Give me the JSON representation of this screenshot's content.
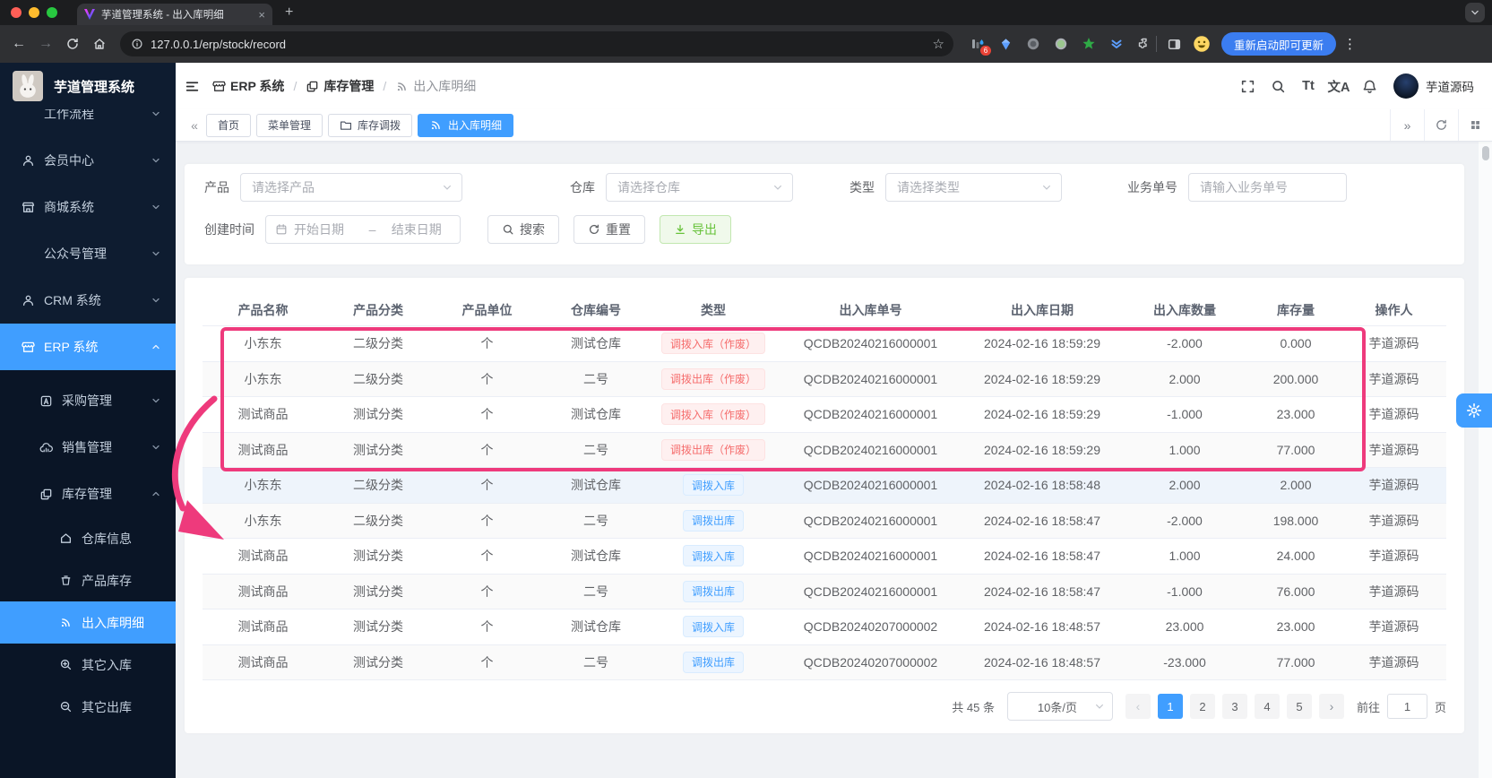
{
  "colors": {
    "accent": "#409eff",
    "annotation": "#ee3a7c",
    "danger": "#f56c6c",
    "success": "#67c23a",
    "sidebar_bg": "#0e1c30"
  },
  "glyphs": {
    "back": "←",
    "forward": "→",
    "star": "☆",
    "newtab": "+",
    "close": "×",
    "dots": "⋮",
    "collapse": "«",
    "expand": "»",
    "prev": "‹",
    "next": "›"
  },
  "browser": {
    "tab_title": "芋道管理系统 - 出入库明细",
    "url": "127.0.0.1/erp/stock/record",
    "extension_badge": "6",
    "update_button": "重新启动即可更新"
  },
  "sidebar": {
    "app_title": "芋道管理系统",
    "items": [
      {
        "label": "工作流程",
        "icon": null,
        "chevron": "down",
        "level": 1,
        "active": false
      },
      {
        "label": "会员中心",
        "icon": "member",
        "chevron": "down",
        "level": 1,
        "active": false
      },
      {
        "label": "商城系统",
        "icon": "mall",
        "chevron": "down",
        "level": 1,
        "active": false
      },
      {
        "label": "公众号管理",
        "icon": null,
        "chevron": "down",
        "level": 1,
        "active": false
      },
      {
        "label": "CRM 系统",
        "icon": "user",
        "chevron": "down",
        "level": 1,
        "active": false
      },
      {
        "label": "ERP 系统",
        "icon": "store",
        "chevron": "up",
        "level": 1,
        "active": true
      },
      {
        "label": "采购管理",
        "icon": "purchase",
        "chevron": "down",
        "level": 2,
        "active": false
      },
      {
        "label": "销售管理",
        "icon": "sale",
        "chevron": "down",
        "level": 2,
        "active": false
      },
      {
        "label": "库存管理",
        "icon": "stock",
        "chevron": "up",
        "level": 2,
        "active": false
      },
      {
        "label": "仓库信息",
        "icon": "house",
        "chevron": null,
        "level": 3,
        "active": false
      },
      {
        "label": "产品库存",
        "icon": "cup",
        "chevron": null,
        "level": 3,
        "active": false
      },
      {
        "label": "出入库明细",
        "icon": "signal",
        "chevron": null,
        "level": 3,
        "active": true
      },
      {
        "label": "其它入库",
        "icon": "zoom-in",
        "chevron": null,
        "level": 3,
        "active": false
      },
      {
        "label": "其它出库",
        "icon": "zoom-out",
        "chevron": null,
        "level": 3,
        "active": false
      }
    ]
  },
  "header": {
    "breadcrumb": [
      {
        "label": "ERP 系统",
        "icon": "store"
      },
      {
        "label": "库存管理",
        "icon": "stock"
      },
      {
        "label": "出入库明细",
        "icon": "signal"
      }
    ],
    "tt_icon": "Tt",
    "translate_icon": "文A",
    "username": "芋道源码"
  },
  "tabs": {
    "items": [
      {
        "label": "首页",
        "icon": null,
        "active": false
      },
      {
        "label": "菜单管理",
        "icon": null,
        "active": false
      },
      {
        "label": "库存调拨",
        "icon": "folder",
        "active": false
      },
      {
        "label": "出入库明细",
        "icon": "signal",
        "active": true
      }
    ]
  },
  "filters": {
    "product_label": "产品",
    "product_placeholder": "请选择产品",
    "warehouse_label": "仓库",
    "warehouse_placeholder": "请选择仓库",
    "type_label": "类型",
    "type_placeholder": "请选择类型",
    "bizno_label": "业务单号",
    "bizno_placeholder": "请输入业务单号",
    "created_label": "创建时间",
    "date_start_placeholder": "开始日期",
    "date_separator": "–",
    "date_end_placeholder": "结束日期",
    "search_button": "搜索",
    "reset_button": "重置",
    "export_button": "导出"
  },
  "table": {
    "columns": [
      "产品名称",
      "产品分类",
      "产品单位",
      "仓库编号",
      "类型",
      "出入库单号",
      "出入库日期",
      "出入库数量",
      "库存量",
      "操作人"
    ],
    "rows": [
      {
        "product": "小东东",
        "category": "二级分类",
        "unit": "个",
        "warehouse": "测试仓库",
        "type": "调拨入库（作废）",
        "type_style": "danger",
        "order_no": "QCDB20240216000001",
        "date": "2024-02-16 18:59:29",
        "quantity": "-2.000",
        "stock": "0.000",
        "operator": "芋道源码"
      },
      {
        "product": "小东东",
        "category": "二级分类",
        "unit": "个",
        "warehouse": "二号",
        "type": "调拨出库（作废）",
        "type_style": "danger",
        "order_no": "QCDB20240216000001",
        "date": "2024-02-16 18:59:29",
        "quantity": "2.000",
        "stock": "200.000",
        "operator": "芋道源码"
      },
      {
        "product": "测试商品",
        "category": "测试分类",
        "unit": "个",
        "warehouse": "测试仓库",
        "type": "调拨入库（作废）",
        "type_style": "danger",
        "order_no": "QCDB20240216000001",
        "date": "2024-02-16 18:59:29",
        "quantity": "-1.000",
        "stock": "23.000",
        "operator": "芋道源码"
      },
      {
        "product": "测试商品",
        "category": "测试分类",
        "unit": "个",
        "warehouse": "二号",
        "type": "调拨出库（作废）",
        "type_style": "danger",
        "order_no": "QCDB20240216000001",
        "date": "2024-02-16 18:59:29",
        "quantity": "1.000",
        "stock": "77.000",
        "operator": "芋道源码"
      },
      {
        "product": "小东东",
        "category": "二级分类",
        "unit": "个",
        "warehouse": "测试仓库",
        "type": "调拨入库",
        "type_style": "primary",
        "order_no": "QCDB20240216000001",
        "date": "2024-02-16 18:58:48",
        "quantity": "2.000",
        "stock": "2.000",
        "operator": "芋道源码"
      },
      {
        "product": "小东东",
        "category": "二级分类",
        "unit": "个",
        "warehouse": "二号",
        "type": "调拨出库",
        "type_style": "primary",
        "order_no": "QCDB20240216000001",
        "date": "2024-02-16 18:58:47",
        "quantity": "-2.000",
        "stock": "198.000",
        "operator": "芋道源码"
      },
      {
        "product": "测试商品",
        "category": "测试分类",
        "unit": "个",
        "warehouse": "测试仓库",
        "type": "调拨入库",
        "type_style": "primary",
        "order_no": "QCDB20240216000001",
        "date": "2024-02-16 18:58:47",
        "quantity": "1.000",
        "stock": "24.000",
        "operator": "芋道源码"
      },
      {
        "product": "测试商品",
        "category": "测试分类",
        "unit": "个",
        "warehouse": "二号",
        "type": "调拨出库",
        "type_style": "primary",
        "order_no": "QCDB20240216000001",
        "date": "2024-02-16 18:58:47",
        "quantity": "-1.000",
        "stock": "76.000",
        "operator": "芋道源码"
      },
      {
        "product": "测试商品",
        "category": "测试分类",
        "unit": "个",
        "warehouse": "测试仓库",
        "type": "调拨入库",
        "type_style": "primary",
        "order_no": "QCDB20240207000002",
        "date": "2024-02-16 18:48:57",
        "quantity": "23.000",
        "stock": "23.000",
        "operator": "芋道源码"
      },
      {
        "product": "测试商品",
        "category": "测试分类",
        "unit": "个",
        "warehouse": "二号",
        "type": "调拨出库",
        "type_style": "primary",
        "order_no": "QCDB20240207000002",
        "date": "2024-02-16 18:48:57",
        "quantity": "-23.000",
        "stock": "77.000",
        "operator": "芋道源码"
      }
    ]
  },
  "pagination": {
    "total_text": "共 45 条",
    "page_size": "10条/页",
    "pages": [
      "1",
      "2",
      "3",
      "4",
      "5"
    ],
    "current_page": "1",
    "goto_label": "前往",
    "goto_value": "1",
    "page_unit": "页"
  }
}
